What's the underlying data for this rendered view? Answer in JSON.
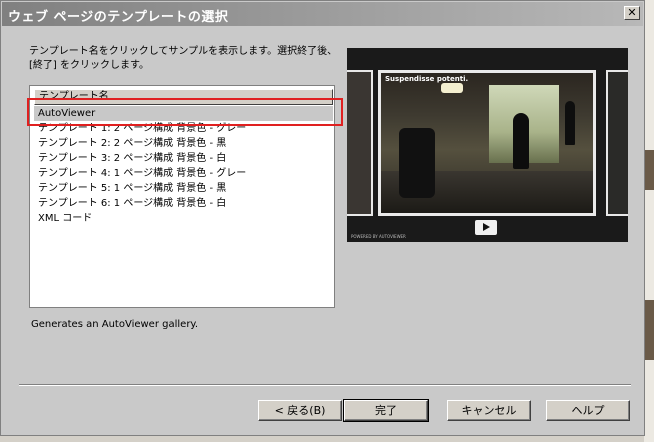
{
  "dialog": {
    "title": "ウェブ ページのテンプレートの選択",
    "close_label": "✕"
  },
  "instruction": "テンプレート名をクリックしてサンプルを表示します。選択終了後、[終了] をクリックします。",
  "list": {
    "header": "テンプレート名",
    "items": [
      "AutoViewer",
      "テンプレート 1: 2 ページ構成 背景色 - グレー",
      "テンプレート 2: 2 ページ構成 背景色 - 黒",
      "テンプレート 3: 2 ページ構成 背景色 - 白",
      "テンプレート 4: 1 ページ構成 背景色 - グレー",
      "テンプレート 5: 1 ページ構成 背景色 - 黒",
      "テンプレート 6: 1 ページ構成 背景色 - 白",
      "XML コード"
    ],
    "selected_index": 0
  },
  "preview": {
    "caption": "Suspendisse potenti.",
    "powered": "POWERED BY AUTOVIEWER",
    "play_icon": "play-icon"
  },
  "description": "Generates an AutoViewer gallery.",
  "buttons": {
    "back": "< 戻る(B)",
    "finish": "完了",
    "cancel": "キャンセル",
    "help": "ヘルプ"
  },
  "colors": {
    "highlight": "#e02020",
    "selection": "#c8c8c8"
  }
}
